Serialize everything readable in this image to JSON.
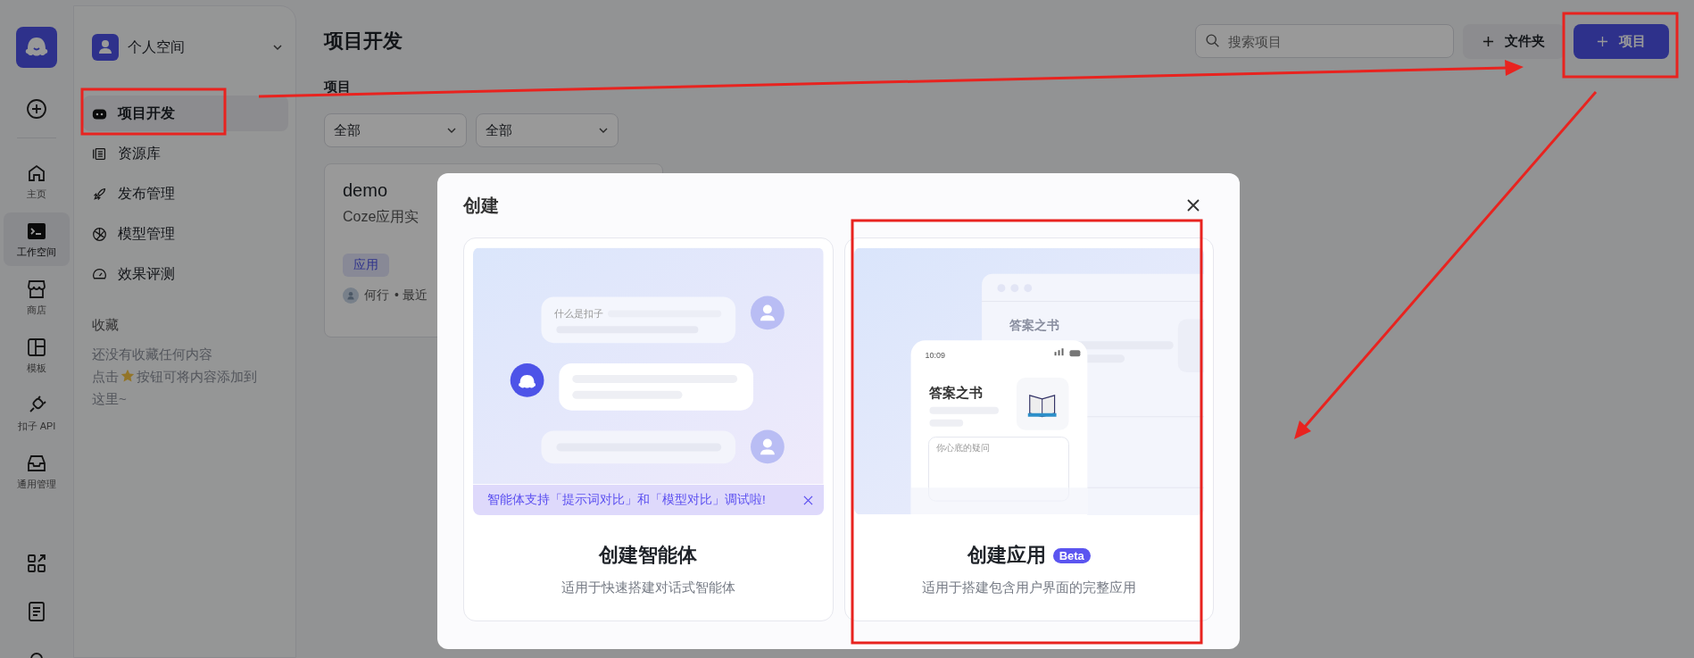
{
  "rail": {
    "items": [
      {
        "label": "主页",
        "selected": false
      },
      {
        "label": "工作空间",
        "selected": true
      },
      {
        "label": "商店",
        "selected": false
      },
      {
        "label": "模板",
        "selected": false
      },
      {
        "label": "扣子 API",
        "selected": false
      },
      {
        "label": "通用管理",
        "selected": false
      }
    ]
  },
  "sidebar": {
    "space": "个人空间",
    "nav": [
      {
        "label": "项目开发",
        "selected": true
      },
      {
        "label": "资源库",
        "selected": false
      },
      {
        "label": "发布管理",
        "selected": false
      },
      {
        "label": "模型管理",
        "selected": false
      },
      {
        "label": "效果评测",
        "selected": false
      }
    ],
    "favorites": {
      "title": "收藏",
      "empty": "还没有收藏任何内容",
      "hint_before": "点击",
      "hint_after": "按钮可将内容添加到",
      "hint_end": "这里~"
    }
  },
  "main": {
    "title": "项目开发",
    "search": {
      "placeholder": "搜索项目"
    },
    "folder_button": "文件夹",
    "new_button": "项目",
    "section": "项目",
    "filters": [
      {
        "value": "全部"
      },
      {
        "value": "全部"
      }
    ],
    "cards": [
      {
        "title": "demo",
        "description": "Coze应用实",
        "tag": "应用",
        "owner": "何行",
        "meta": "• 最近"
      }
    ]
  },
  "modal": {
    "title": "创建",
    "options": [
      {
        "kind": "agent",
        "title": "创建智能体",
        "subtitle": "适用于快速搭建对话式智能体",
        "banner": "智能体支持「提示词对比」和「模型对比」调试啦!",
        "question": "什么是扣子"
      },
      {
        "kind": "app",
        "title": "创建应用",
        "badge": "Beta",
        "subtitle": "适用于搭建包含用户界面的完整应用",
        "app_name_back": "答案之书",
        "app_name": "答案之书",
        "time": "10:09",
        "input_placeholder": "你心底的疑问"
      }
    ]
  }
}
